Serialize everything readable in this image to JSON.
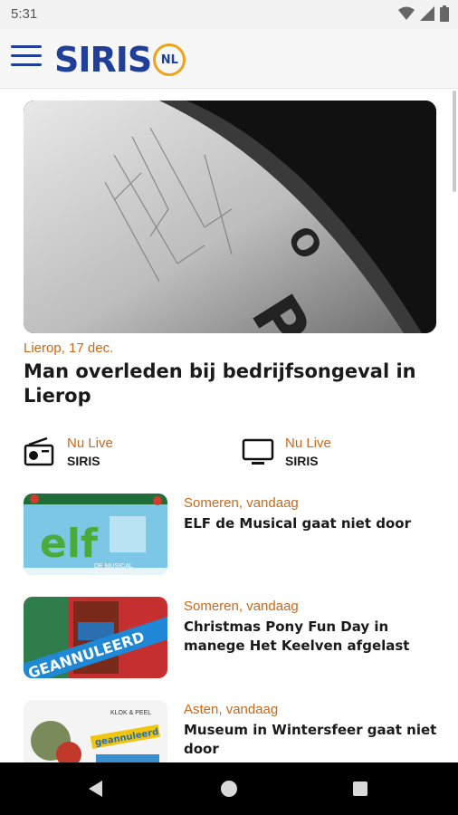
{
  "status": {
    "time": "5:31"
  },
  "app": {
    "logo_text": "SIRIS",
    "logo_badge": "NL"
  },
  "hero": {
    "meta": "Lierop, 17 dec.",
    "title": "Man overleden bij bedrijfsongeval in Lierop"
  },
  "live": [
    {
      "label": "Nu Live",
      "channel": "SIRIS",
      "icon": "radio-icon"
    },
    {
      "label": "Nu Live",
      "channel": "SIRIS",
      "icon": "tv-icon"
    }
  ],
  "news": [
    {
      "meta": "Someren, vandaag",
      "title": "ELF de Musical gaat niet door",
      "thumb_text": "elf",
      "thumb_sub": "DE MUSICAL"
    },
    {
      "meta": "Someren, vandaag",
      "title": "Christmas Pony Fun Day in manege Het Keelven afgelast",
      "thumb_text": "GEANNULEERD"
    },
    {
      "meta": "Asten, vandaag",
      "title": "Museum in Wintersfeer gaat niet door",
      "thumb_text": "geannuleerd",
      "thumb_sub": "KLOK & PEEL"
    }
  ],
  "colors": {
    "brand": "#1f3f99",
    "accent": "#c8691a",
    "badge": "#f0a21a"
  }
}
